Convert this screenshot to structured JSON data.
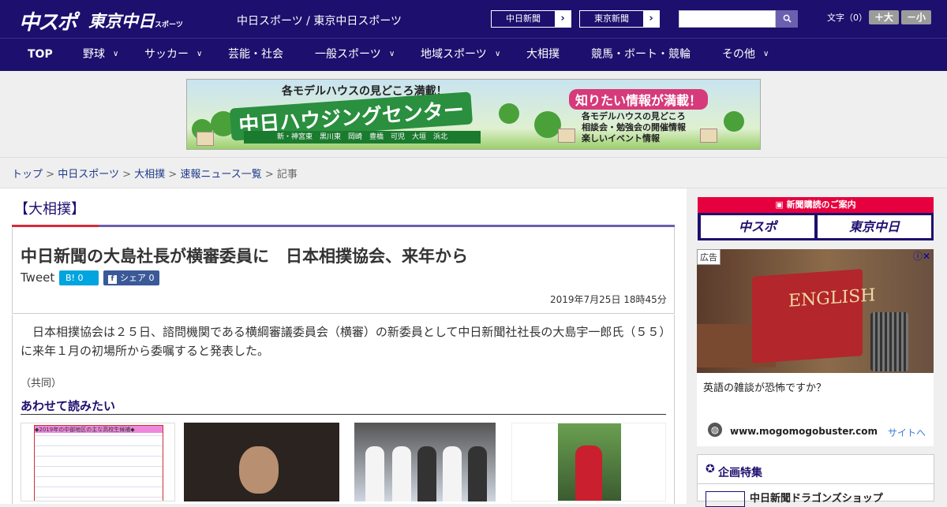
{
  "header": {
    "logo_chusupo": "中スポ",
    "logo_tokyo": "東京中日",
    "logo_tokyo_small": "スポーツ",
    "site_title": "中日スポーツ / 東京中日スポーツ",
    "paper_links": [
      {
        "label": "中日新聞",
        "arrow": "›"
      },
      {
        "label": "東京新聞",
        "arrow": "›"
      }
    ],
    "search": {
      "placeholder": "",
      "icon": "search-icon"
    },
    "font_size_label": "文字（0）",
    "font_larger": "＋大",
    "font_smaller": "－小"
  },
  "nav": {
    "items": [
      {
        "label": "TOP",
        "has_chevron": false
      },
      {
        "label": "野球",
        "has_chevron": true
      },
      {
        "label": "サッカー",
        "has_chevron": true
      },
      {
        "label": "芸能・社会",
        "has_chevron": false
      },
      {
        "label": "一般スポーツ",
        "has_chevron": true
      },
      {
        "label": "地域スポーツ",
        "has_chevron": true
      },
      {
        "label": "大相撲",
        "has_chevron": false
      },
      {
        "label": "競馬・ボート・競輪",
        "has_chevron": false
      },
      {
        "label": "その他",
        "has_chevron": true
      }
    ],
    "chevron": "∨"
  },
  "banner": {
    "top_text": "各モデルハウスの見どころ満載！",
    "main_text": "中日ハウジングセンター",
    "locations": "新・神宮東　黒川東　岡崎　豊橋　可児　大垣　浜北",
    "right_headline": "知りたい情報が満載！",
    "right_items": [
      "各モデルハウスの見どころ",
      "相談会・勉強会の開催情報",
      "楽しいイベント情報"
    ]
  },
  "breadcrumb": {
    "items": [
      "トップ",
      "中日スポーツ",
      "大相撲",
      "速報ニュース一覧"
    ],
    "separator": ">",
    "current": "記事"
  },
  "article": {
    "category": "【大相撲】",
    "headline": "中日新聞の大島社長が横審委員に　日本相撲協会、来年から",
    "tweet_label": "Tweet",
    "hatena_label": "B! 0",
    "fb_label": "シェア 0",
    "date": "2019年7月25日 18時45分",
    "body": "日本相撲協会は２５日、諮問機関である横綱審議委員会（横審）の新委員として中日新聞社社長の大島宇一郎氏（５５）に来年１月の初場所から委嘱すると発表した。",
    "credit": "（共同）",
    "related_heading": "あわせて読みたい",
    "related_thumb1_caption": "◆2019年の中部地区の主な高校生候補◆"
  },
  "sidebar": {
    "subscription_heading": "新聞購読のご案内",
    "subscription_buttons": [
      "中スポ",
      "東京中日"
    ],
    "ad": {
      "label": "広告",
      "book_text": "ENGLISH",
      "title": "英語の雑談が恐怖ですか？",
      "url": "www.mogomogobuster.com",
      "link": "サイトへ"
    },
    "feature_heading": "企画特集",
    "feature_item": "中日新聞ドラゴンズショップ"
  },
  "colors": {
    "brand_navy": "#1d0f6e",
    "accent_red": "#d62b3a",
    "accent_purple": "#6b5fb0",
    "hatena_blue": "#00a4de",
    "facebook_blue": "#3b5998"
  }
}
